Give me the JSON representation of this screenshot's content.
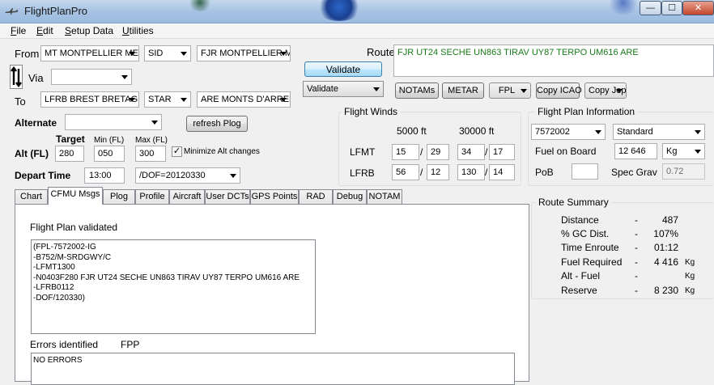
{
  "window": {
    "title": "FlightPlanPro",
    "controls": {
      "minimize": "—",
      "maximize": "☐",
      "close": "✕"
    }
  },
  "menu": [
    "File",
    "Edit",
    "Setup Data",
    "Utilities"
  ],
  "route_setup": {
    "from_label": "From",
    "from_value": "MT MONTPELLIER ME",
    "sid_value": "SID",
    "sid_fix_value": "FJR MONTPELLIER MEDI",
    "via_label": "Via",
    "via_value": "",
    "to_label": "To",
    "to_value": "LFRB BREST BRETAGN",
    "star_value": "STAR",
    "star_fix_value": "ARE MONTS D'ARREE LE",
    "route_label": "Route",
    "route_text": "FJR UT24 SECHE UN863 TIRAV UY87 TERPO UM616 ARE",
    "validate_button": "Validate",
    "validate_combo": "Validate",
    "buttons": {
      "notams": "NOTAMs",
      "metar": "METAR",
      "fpl": "FPL",
      "copy_icao": "Copy ICAO",
      "copy_jepp": "Copy Jepp"
    }
  },
  "alternate": {
    "label": "Alternate",
    "value": "",
    "refresh_button": "refresh Plog"
  },
  "altitude": {
    "label": "Alt (FL)",
    "target_header": "Target",
    "min_header": "Min  (FL)",
    "max_header": "Max (FL)",
    "target": "280",
    "min": "050",
    "max": "300",
    "minimize_label": "Minimize Alt changes",
    "minimize_checked": true
  },
  "departure": {
    "label": "Depart Time",
    "time": "13:00",
    "dof": "/DOF=20120330"
  },
  "flight_winds": {
    "title": "Flight Winds",
    "col1": "5000 ft",
    "col2": "30000 ft",
    "rows": [
      {
        "label": "LFMT",
        "a1": "15",
        "b1": "29",
        "a2": "34",
        "b2": "17"
      },
      {
        "label": "LFRB",
        "a1": "56",
        "b1": "12",
        "a2": "130",
        "b2": "14"
      }
    ],
    "sep": "/"
  },
  "flight_plan_info": {
    "title": "Flight Plan Information",
    "aircraft": "7572002",
    "mode": "Standard",
    "fuel_label": "Fuel on Board",
    "fuel_value": "12 646",
    "fuel_unit": "Kg",
    "pob_label": "PoB",
    "pob_value": "",
    "spec_grav_label": "Spec Grav",
    "spec_grav_value": "0.72"
  },
  "tabs": [
    "Chart",
    "CFMU Msgs",
    "Plog",
    "Profile",
    "Aircraft",
    "User DCTs",
    "GPS Points",
    "RAD",
    "Debug",
    "NOTAM"
  ],
  "active_tab": "CFMU Msgs",
  "cfmu": {
    "status": "Flight Plan validated",
    "message": "(FPL-7572002-IG\n-B752/M-SRDGWY/C\n-LFMT1300\n-N0403F280 FJR UT24 SECHE UN863 TIRAV UY87 TERPO UM616 ARE\n-LFRB0112\n-DOF/120330)",
    "errors_label": "Errors identified",
    "fpp_label": "FPP",
    "errors_text": "NO ERRORS"
  },
  "route_summary": {
    "title": "Route Summary",
    "rows": [
      {
        "label": "Distance",
        "dash": "-",
        "value": "487",
        "unit": ""
      },
      {
        "label": "% GC Dist.",
        "dash": "-",
        "value": "107%",
        "unit": ""
      },
      {
        "label": "Time Enroute",
        "dash": "-",
        "value": "01:12",
        "unit": ""
      },
      {
        "label": "Fuel Required",
        "dash": "-",
        "value": "4 416",
        "unit": "Kg"
      },
      {
        "label": "Alt - Fuel",
        "dash": "-",
        "value": "",
        "unit": "Kg"
      },
      {
        "label": "Reserve",
        "dash": "-",
        "value": "8 230",
        "unit": "Kg"
      }
    ]
  },
  "colors": {
    "route_text": "#1a7a1a",
    "titlebar": "#a9c4e4"
  }
}
